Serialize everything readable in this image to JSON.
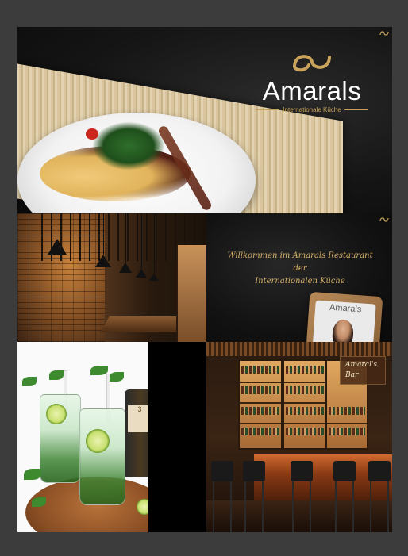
{
  "brand": {
    "name": "Amarals",
    "tagline": "Internationale Küche",
    "logo_icon": "infinity-a-icon"
  },
  "welcome": {
    "text_line1": "Willkommen im Amarals Restaurant der",
    "text_line2": "Internationalen Küche",
    "card_title": "Amarals"
  },
  "bar": {
    "sign_line1": "Amaral's",
    "sign_line2": "Bar"
  },
  "mojito": {
    "bottle_label": "3"
  },
  "colors": {
    "background": "#3c3c3c",
    "gold": "#c9a35c",
    "welcome_text": "#d6b06a"
  }
}
